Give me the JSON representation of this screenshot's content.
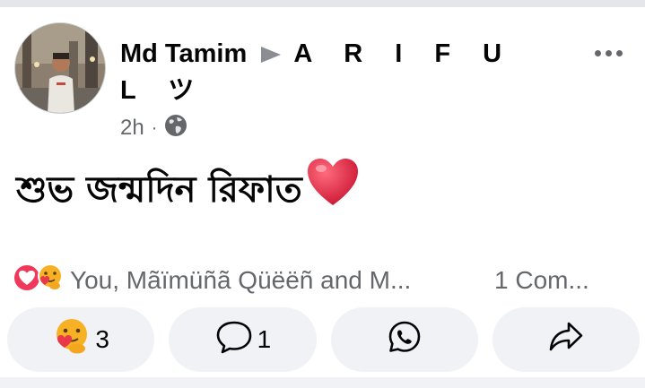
{
  "post": {
    "author_name": "Md Tamim",
    "author_tagged": "A R I F U L ツ",
    "time": "2h",
    "separator": "·",
    "privacy_icon": "globe-icon",
    "text": "শুভ জন্মদিন রিফাত",
    "text_emoji": "heart-emoji"
  },
  "reactions": {
    "icons": [
      "heart-reaction-icon",
      "care-reaction-icon"
    ],
    "summary": "You, Mãïmüñã Qüëëñ and M...",
    "comments_count": "1 Com..."
  },
  "actions": {
    "react_count": "3",
    "comment_count": "1",
    "react_icon": "care-reaction-icon",
    "comment_icon": "comment-bubble-icon",
    "whatsapp_icon": "whatsapp-icon",
    "share_icon": "share-arrow-icon"
  },
  "colors": {
    "heart": "#e4294a",
    "care_face": "#f5b931",
    "meta_gray": "#65676b",
    "button_bg": "#f0f2f5"
  }
}
